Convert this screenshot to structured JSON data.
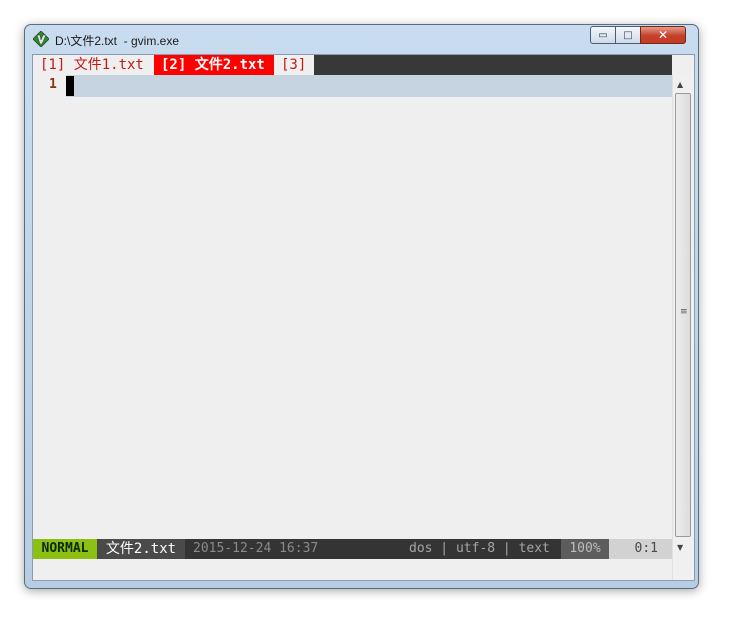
{
  "window": {
    "title": "D:\\文件2.txt  - gvim.exe",
    "icon": "vim-app-icon",
    "controls": {
      "minimize": "▭",
      "maximize": "□",
      "close": "✕"
    }
  },
  "tabs": [
    {
      "label": "[1] 文件1.txt",
      "active": false
    },
    {
      "label": "[2] 文件2.txt",
      "active": true
    },
    {
      "label": "[3]",
      "active": false
    }
  ],
  "editor": {
    "line_numbers": [
      "1"
    ],
    "lines": [
      ""
    ],
    "cursor": {
      "line": 1,
      "col": 0
    }
  },
  "statusline": {
    "mode": "NORMAL",
    "filename": "文件2.txt",
    "datetime": "2015-12-24 16:37",
    "fileinfo": "dos | utf-8 | text",
    "percent": "100%",
    "position": "0:1"
  },
  "scrollbar": {
    "up_arrow": "▲",
    "down_arrow": "▼",
    "grip": "≡"
  },
  "colors": {
    "tab_active_bg": "#ff0000",
    "tab_inactive_fg": "#c41818",
    "mode_bg": "#8dc013",
    "cursorline_bg": "#c6d4e2",
    "statusline_bg": "#343434"
  }
}
